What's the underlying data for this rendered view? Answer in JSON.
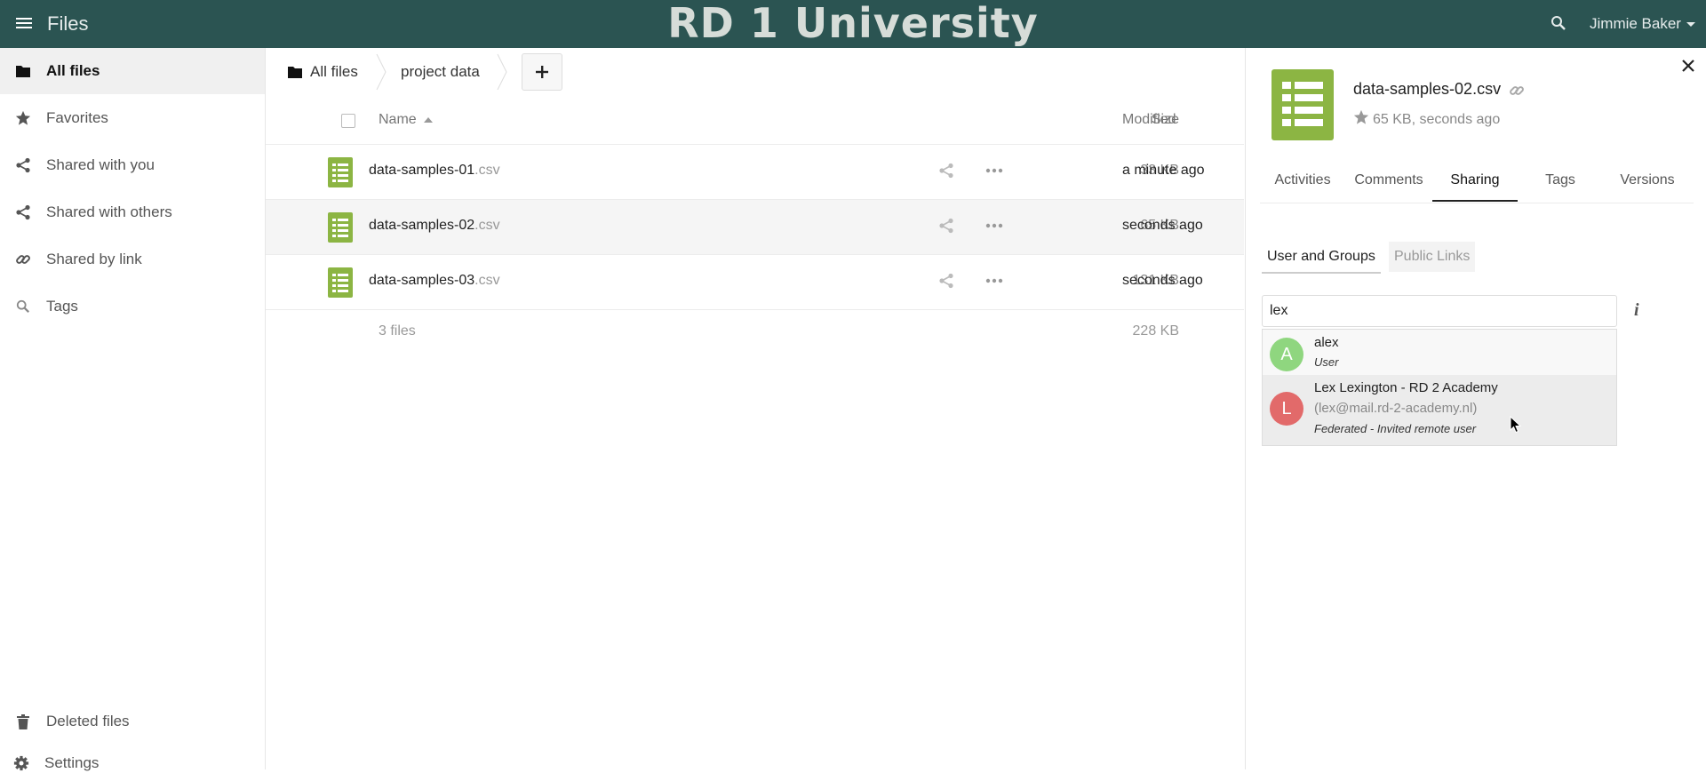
{
  "header": {
    "app_name": "Files",
    "brand": "RD 1 University",
    "user": "Jimmie Baker",
    "bg_color": "#2b5452"
  },
  "sidebar": {
    "items": [
      {
        "label": "All files",
        "icon": "folder-icon",
        "active": true
      },
      {
        "label": "Favorites",
        "icon": "star-icon"
      },
      {
        "label": "Shared with you",
        "icon": "share-icon"
      },
      {
        "label": "Shared with others",
        "icon": "share-icon"
      },
      {
        "label": "Shared by link",
        "icon": "link-icon"
      },
      {
        "label": "Tags",
        "icon": "search-icon"
      }
    ],
    "bottom": [
      {
        "label": "Deleted files",
        "icon": "trash-icon"
      },
      {
        "label": "Settings",
        "icon": "gear-icon"
      }
    ]
  },
  "breadcrumb": [
    "All files",
    "project data"
  ],
  "table": {
    "headers": {
      "name": "Name",
      "size": "Size",
      "modified": "Modified"
    },
    "rows": [
      {
        "base": "data-samples-01",
        "ext": ".csv",
        "size": "33 KB",
        "modified": "a minute ago"
      },
      {
        "base": "data-samples-02",
        "ext": ".csv",
        "size": "65 KB",
        "modified": "seconds ago",
        "selected": true
      },
      {
        "base": "data-samples-03",
        "ext": ".csv",
        "size": "131 KB",
        "modified": "seconds ago"
      }
    ],
    "summary": {
      "count": "3 files",
      "total": "228 KB"
    }
  },
  "details": {
    "filename": "data-samples-02.csv",
    "meta": "65 KB, seconds ago",
    "tabs": [
      "Activities",
      "Comments",
      "Sharing",
      "Tags",
      "Versions"
    ],
    "active_tab": "Sharing",
    "subtabs": [
      "User and Groups",
      "Public Links"
    ],
    "search_value": "lex",
    "results": [
      {
        "initial": "A",
        "name": "alex",
        "type": "User",
        "color": "#8fd67f"
      },
      {
        "initial": "L",
        "name": "Lex Lexington - RD 2 Academy",
        "email": "(lex@mail.rd-2-academy.nl)",
        "type": "Federated - Invited remote user",
        "color": "#e26a6a"
      }
    ]
  },
  "colors": {
    "file_icon": "#8cb543",
    "accent": "#2b5452"
  }
}
